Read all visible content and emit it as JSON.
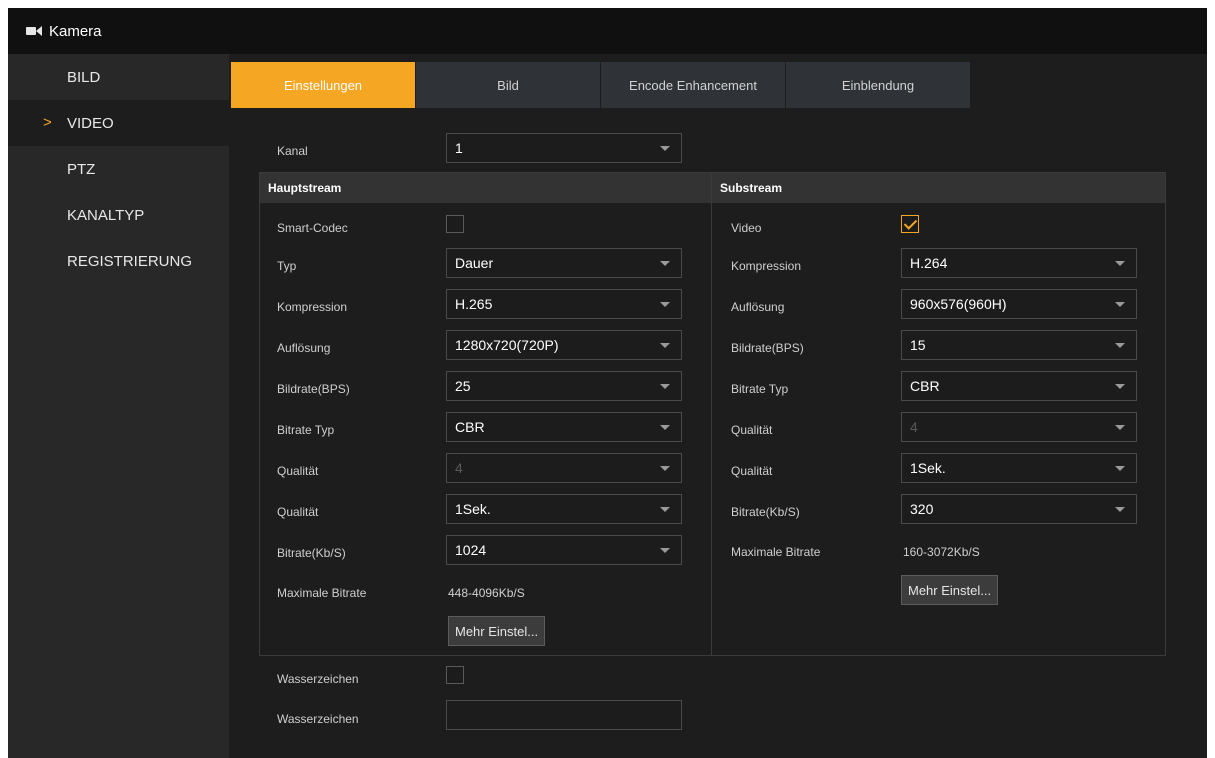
{
  "titlebar": {
    "title": "Kamera",
    "icon": "camera-icon"
  },
  "sidebar": {
    "items": [
      {
        "label": "BILD",
        "active": false
      },
      {
        "label": "VIDEO",
        "active": true
      },
      {
        "label": "PTZ",
        "active": false
      },
      {
        "label": "KANALTYP",
        "active": false
      },
      {
        "label": "REGISTRIERUNG",
        "active": false
      }
    ],
    "active_marker": ">"
  },
  "tabs": [
    {
      "label": "Einstellungen",
      "active": true
    },
    {
      "label": "Bild",
      "active": false
    },
    {
      "label": "Encode Enhancement",
      "active": false
    },
    {
      "label": "Einblendung",
      "active": false
    }
  ],
  "channel": {
    "label": "Kanal",
    "value": "1"
  },
  "main_stream": {
    "header": "Hauptstream",
    "smart_codec_label": "Smart-Codec",
    "smart_codec_checked": false,
    "type_label": "Typ",
    "type_value": "Dauer",
    "compression_label": "Kompression",
    "compression_value": "H.265",
    "resolution_label": "Auflösung",
    "resolution_value": "1280x720(720P)",
    "framerate_label": "Bildrate(BPS)",
    "framerate_value": "25",
    "bitrate_type_label": "Bitrate Typ",
    "bitrate_type_value": "CBR",
    "quality_label": "Qualität",
    "quality_value": "4",
    "iframe_label": "Qualität",
    "iframe_value": "1Sek.",
    "bitrate_label": "Bitrate(Kb/S)",
    "bitrate_value": "1024",
    "max_bitrate_label": "Maximale Bitrate",
    "max_bitrate_value": "448-4096Kb/S",
    "more_button": "Mehr Einstel..."
  },
  "sub_stream": {
    "header": "Substream",
    "video_label": "Video",
    "video_checked": true,
    "compression_label": "Kompression",
    "compression_value": "H.264",
    "resolution_label": "Auflösung",
    "resolution_value": "960x576(960H)",
    "framerate_label": "Bildrate(BPS)",
    "framerate_value": "15",
    "bitrate_type_label": "Bitrate Typ",
    "bitrate_type_value": "CBR",
    "quality_label": "Qualität",
    "quality_value": "4",
    "iframe_label": "Qualität",
    "iframe_value": "1Sek.",
    "bitrate_label": "Bitrate(Kb/S)",
    "bitrate_value": "320",
    "max_bitrate_label": "Maximale Bitrate",
    "max_bitrate_value": "160-3072Kb/S",
    "more_button": "Mehr Einstel..."
  },
  "watermark": {
    "enable_label": "Wasserzeichen",
    "enable_checked": false,
    "text_label": "Wasserzeichen",
    "text_value": ""
  },
  "colors": {
    "accent": "#f5a623",
    "background": "#1d1d1d",
    "sidebar": "#282828",
    "titlebar": "#101010"
  }
}
